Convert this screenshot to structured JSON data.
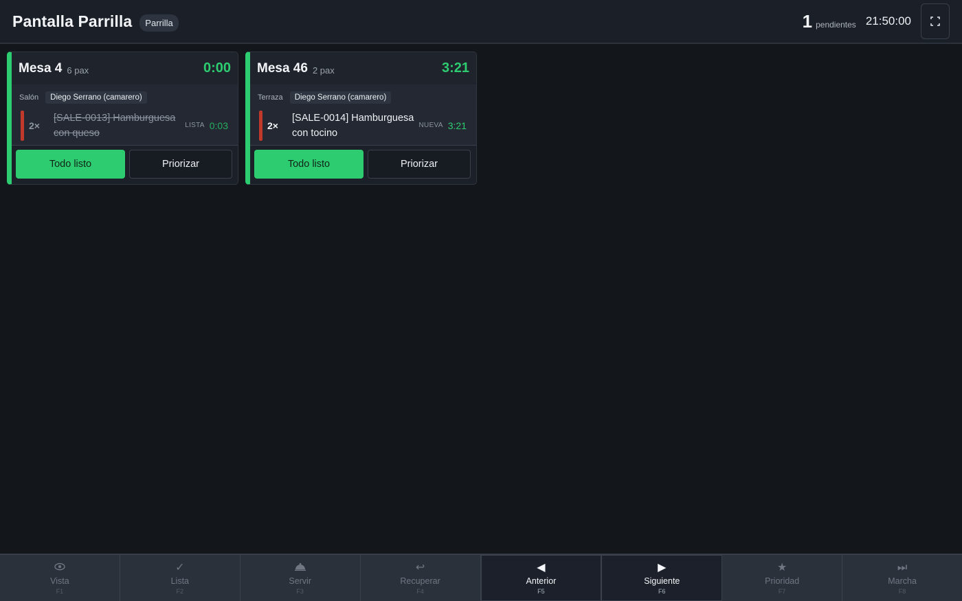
{
  "header": {
    "title": "Pantalla Parrilla",
    "station": "Parrilla",
    "pending_count": "1",
    "pending_label": "pendientes",
    "clock": "21:50:00",
    "fullscreen_icon": "fullscreen-icon"
  },
  "colors": {
    "accent": "#2ecc71",
    "priority": "#c0392b",
    "background": "#13161b"
  },
  "orders": [
    {
      "mesa": "Mesa 4",
      "pax": "6 pax",
      "elapsed": "0:00",
      "zone": "Salón",
      "waiter": "Diego Serrano (camarero)",
      "item": {
        "qty": "2×",
        "name": "[SALE-0013] Hamburguesa con queso",
        "status": "LISTA",
        "time": "0:03"
      },
      "ready_label": "Todo listo",
      "priority_label": "Priorizar"
    },
    {
      "mesa": "Mesa 46",
      "pax": "2 pax",
      "elapsed": "3:21",
      "zone": "Terraza",
      "waiter": "Diego Serrano (camarero)",
      "item": {
        "qty": "2×",
        "name": "[SALE-0014] Hamburguesa con tocino",
        "status": "NUEVA",
        "time": "3:21"
      },
      "ready_label": "Todo listo",
      "priority_label": "Priorizar"
    }
  ],
  "bottom_bar": [
    {
      "label": "Vista",
      "key": "F1",
      "icon": "eye-icon"
    },
    {
      "label": "Lista",
      "key": "F2",
      "icon": "check-icon"
    },
    {
      "label": "Servir",
      "key": "F3",
      "icon": "serve-icon"
    },
    {
      "label": "Recuperar",
      "key": "F4",
      "icon": "undo-icon"
    },
    {
      "label": "Anterior",
      "key": "F5",
      "icon": "arrow-left-icon"
    },
    {
      "label": "Siguiente",
      "key": "F6",
      "icon": "arrow-right-icon"
    },
    {
      "label": "Prioridad",
      "key": "F7",
      "icon": "star-icon"
    },
    {
      "label": "Marcha",
      "key": "F8",
      "icon": "fast-forward-icon"
    }
  ]
}
